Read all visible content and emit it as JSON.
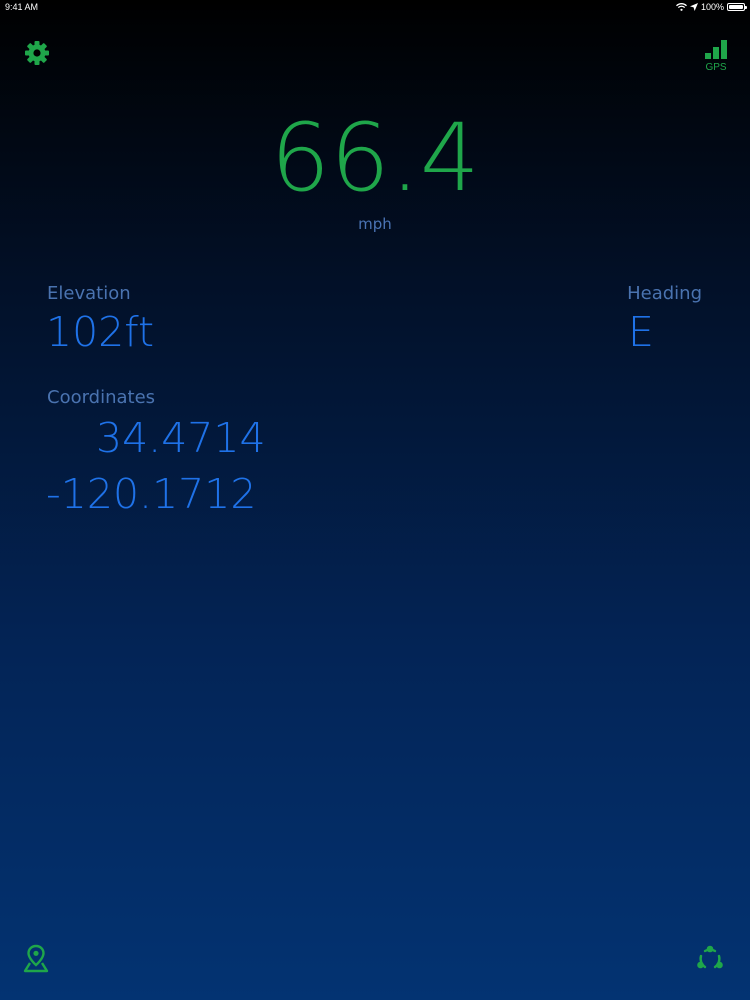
{
  "status_bar": {
    "time": "9:41 AM",
    "battery": "100%",
    "icons": [
      "wifi-icon",
      "location-arrow-icon",
      "battery-icon"
    ]
  },
  "toolbar": {
    "settings_icon": "gear-icon",
    "gps_label": "GPS",
    "gps_signal_level": 1.0
  },
  "speed": {
    "value": "66.4",
    "unit": "mph"
  },
  "elevation": {
    "label": "Elevation",
    "value": "102ft"
  },
  "heading": {
    "label": "Heading",
    "value": "E"
  },
  "coordinates": {
    "label": "Coordinates",
    "latitude": "34.4714",
    "longitude": "-120.1712"
  },
  "bottom_bar": {
    "left_icon": "map-pin-icon",
    "right_icon": "recycle-icon"
  },
  "colors": {
    "accent_green": "#1fa64a",
    "value_blue": "#1f72e8",
    "label_blue": "#4a73b0"
  }
}
